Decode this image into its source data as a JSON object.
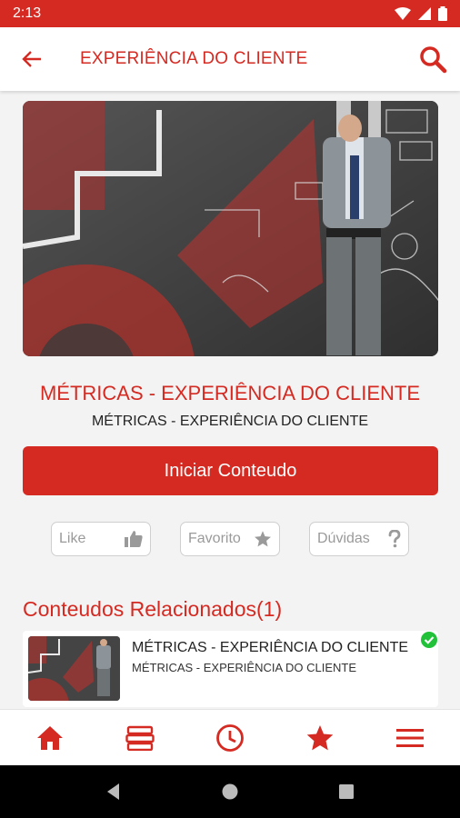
{
  "status": {
    "time": "2:13"
  },
  "appbar": {
    "title": "EXPERIÊNCIA DO CLIENTE"
  },
  "content": {
    "title": "MÉTRICAS - EXPERIÊNCIA DO CLIENTE",
    "subtitle": "MÉTRICAS - EXPERIÊNCIA DO CLIENTE",
    "start_label": "Iniciar Conteudo"
  },
  "actions": {
    "like": "Like",
    "favorite": "Favorito",
    "doubts": "Dúvidas"
  },
  "related": {
    "heading": "Conteudos Relacionados(1)",
    "items": [
      {
        "title": "MÉTRICAS - EXPERIÊNCIA DO CLIENTE",
        "subtitle": "MÉTRICAS - EXPERIÊNCIA DO CLIENTE",
        "completed": true
      }
    ]
  },
  "bottom_nav": [
    "home-icon",
    "books-icon",
    "clock-icon",
    "star-icon",
    "menu-icon"
  ],
  "colors": {
    "brand": "#d52a22",
    "check": "#21c23a"
  }
}
